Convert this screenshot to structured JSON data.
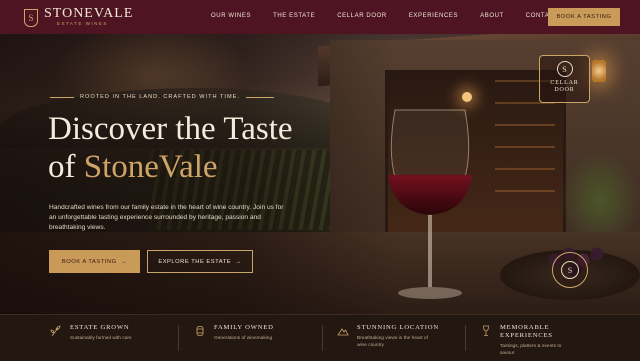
{
  "header": {
    "brand": "STONEVALE",
    "brand_sub": "ESTATE WINES",
    "logo_letter": "S",
    "nav": [
      "OUR WINES",
      "THE ESTATE",
      "CELLAR DOOR",
      "EXPERIENCES",
      "ABOUT",
      "CONTACT"
    ],
    "cta": "BOOK A TASTING"
  },
  "hero": {
    "kicker": "ROOTED IN THE LAND. CRAFTED WITH TIME.",
    "title_line1": "Discover the Taste",
    "title_of": "of",
    "title_accent": "StoneVale",
    "description": "Handcrafted wines from our family estate in the heart of wine country. Join us for an unforgettable tasting experience surrounded by heritage, passion and breathtaking views.",
    "primary_button": "BOOK A TASTING",
    "primary_arrow": "→",
    "secondary_button": "EXPLORE THE ESTATE",
    "secondary_arrow": "→"
  },
  "cellar_sign": {
    "letter": "S",
    "text": "CELLAR DOOR"
  },
  "seal": {
    "letter": "S"
  },
  "features": [
    {
      "icon": "vine-icon",
      "title": "ESTATE GROWN",
      "sub": "Sustainably farmed with care"
    },
    {
      "icon": "barrel-icon",
      "title": "FAMILY OWNED",
      "sub": "Generations of winemaking"
    },
    {
      "icon": "mountain-icon",
      "title": "STUNNING LOCATION",
      "sub": "Breathtaking views in the heart of wine country"
    },
    {
      "icon": "wine-glass-icon",
      "title": "MEMORABLE EXPERIENCES",
      "sub": "Tastings, platters & events to savour"
    }
  ],
  "colors": {
    "header_bg": "#4e1422",
    "accent_gold": "#c99a58",
    "feature_bar_bg": "#231712"
  }
}
